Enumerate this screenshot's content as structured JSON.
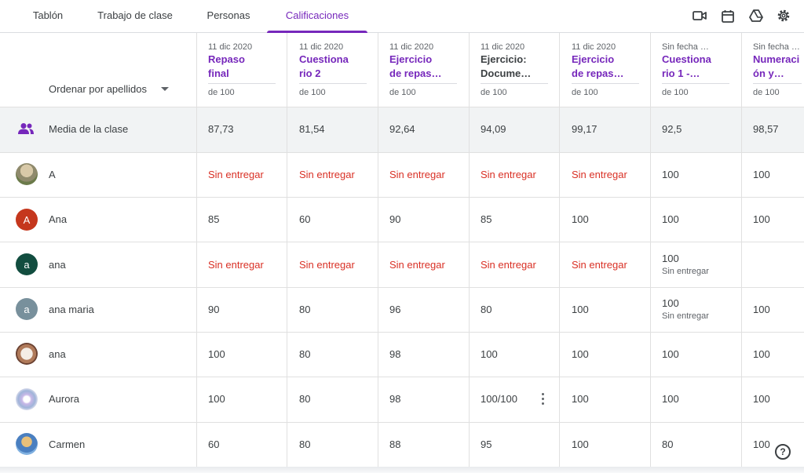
{
  "tabs": [
    "Tablón",
    "Trabajo de clase",
    "Personas",
    "Calificaciones"
  ],
  "active_tab": "Calificaciones",
  "sort_label": "Ordenar por apellidos",
  "points_label": "de 100",
  "columns": [
    {
      "date": "11 dic 2020",
      "title1": "Repaso",
      "title2": "final"
    },
    {
      "date": "11 dic 2020",
      "title1": "Cuestiona",
      "title2": "rio 2"
    },
    {
      "date": "11 dic 2020",
      "title1": "Ejercicio",
      "title2": "de repas…"
    },
    {
      "date": "11 dic 2020",
      "title1": "Ejercicio:",
      "title2": "Documе…"
    },
    {
      "date": "11 dic 2020",
      "title1": "Ejercicio",
      "title2": "de repas…"
    },
    {
      "date": "Sin fecha …",
      "title1": "Cuestiona",
      "title2": "rio 1 -…"
    },
    {
      "date": "Sin fecha …",
      "title1": "Numeraci",
      "title2": "ón y…"
    }
  ],
  "average": {
    "label": "Media de la clase",
    "values": [
      "87,73",
      "81,54",
      "92,64",
      "94,09",
      "99,17",
      "92,5",
      "98,57"
    ]
  },
  "missing_label": "Sin entregar",
  "students": [
    {
      "name": "A",
      "avatar_letter": "",
      "grades": [
        "Sin entregar",
        "Sin entregar",
        "Sin entregar",
        "Sin entregar",
        "Sin entregar",
        "100",
        "100"
      ]
    },
    {
      "name": "Ana",
      "avatar_letter": "A",
      "grades": [
        "85",
        "60",
        "90",
        "85",
        "100",
        "100",
        "100"
      ]
    },
    {
      "name": "ana",
      "avatar_letter": "a",
      "grades": [
        "Sin entregar",
        "Sin entregar",
        "Sin entregar",
        "Sin entregar",
        "Sin entregar",
        "100",
        ""
      ]
    },
    {
      "name": "ana maria",
      "avatar_letter": "a",
      "grades": [
        "90",
        "80",
        "96",
        "80",
        "100",
        "100",
        "100"
      ]
    },
    {
      "name": "ana",
      "avatar_letter": "",
      "grades": [
        "100",
        "80",
        "98",
        "100",
        "100",
        "100",
        "100"
      ]
    },
    {
      "name": "Aurora",
      "avatar_letter": "",
      "grades": [
        "100",
        "80",
        "98",
        "100/100",
        "100",
        "100",
        "100"
      ]
    },
    {
      "name": "Carmen",
      "avatar_letter": "",
      "grades": [
        "60",
        "80",
        "88",
        "95",
        "100",
        "80",
        "100"
      ]
    }
  ],
  "help_label": "?",
  "colors": {
    "accent": "#7627bb",
    "missing": "#d93025",
    "avatar_red": "#c5371d",
    "avatar_green": "#124d3f",
    "avatar_gray": "#78909c"
  },
  "icons": [
    "video-icon",
    "calendar-icon",
    "drive-icon",
    "settings-icon",
    "people-icon",
    "more-vert-icon",
    "help-icon"
  ]
}
